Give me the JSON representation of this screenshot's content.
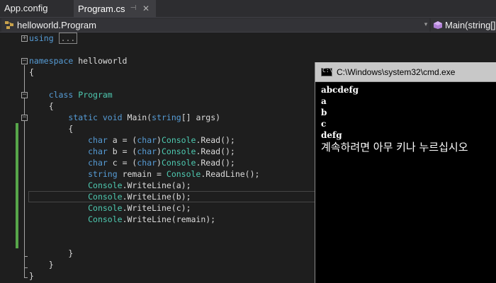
{
  "tabs": [
    {
      "label": "App.config"
    },
    {
      "label": "Program.cs"
    }
  ],
  "icons": {
    "pin": "pin-icon",
    "close": "close-icon",
    "class": "class-icon",
    "method": "method-icon",
    "dropdown": "chevron-down-icon",
    "console": "console-icon"
  },
  "navbar": {
    "class_label": "helloworld.Program",
    "member_label": "Main(string[]"
  },
  "code": {
    "using_kw": "using",
    "using_collapsed": "...",
    "namespace_kw": "namespace",
    "namespace_name": "helloworld",
    "open_brace": "{",
    "close_brace": "}",
    "class_kw": "class",
    "class_name": "Program",
    "static_kw": "static",
    "void_kw": "void",
    "main_sig": "Main(",
    "string_kw": "string",
    "args_rest": "[] args)",
    "char_kw": "char",
    "var_a": " a = (",
    "var_b": " b = (",
    "var_c": " c = (",
    "cast_end": ")",
    "console": "Console",
    "read_call": ".Read();",
    "remain_decl": " remain = ",
    "readline_call": ".ReadLine();",
    "wl_a": ".WriteLine(a);",
    "wl_b": ".WriteLine(b);",
    "wl_c": ".WriteLine(c);",
    "wl_remain": ".WriteLine(remain);"
  },
  "console_window": {
    "title": "C:\\Windows\\system32\\cmd.exe",
    "icon_text": "C:\\",
    "lines": [
      "abcdefg",
      "a",
      "b",
      "c",
      "defg"
    ],
    "prompt": "계속하려면 아무 키나 누르십시오"
  },
  "colors": {
    "keyword": "#569cd6",
    "type": "#4ec9b0",
    "text": "#dcdcdc",
    "change_marker": "#57a64a",
    "editor_bg": "#1e1e1e"
  }
}
